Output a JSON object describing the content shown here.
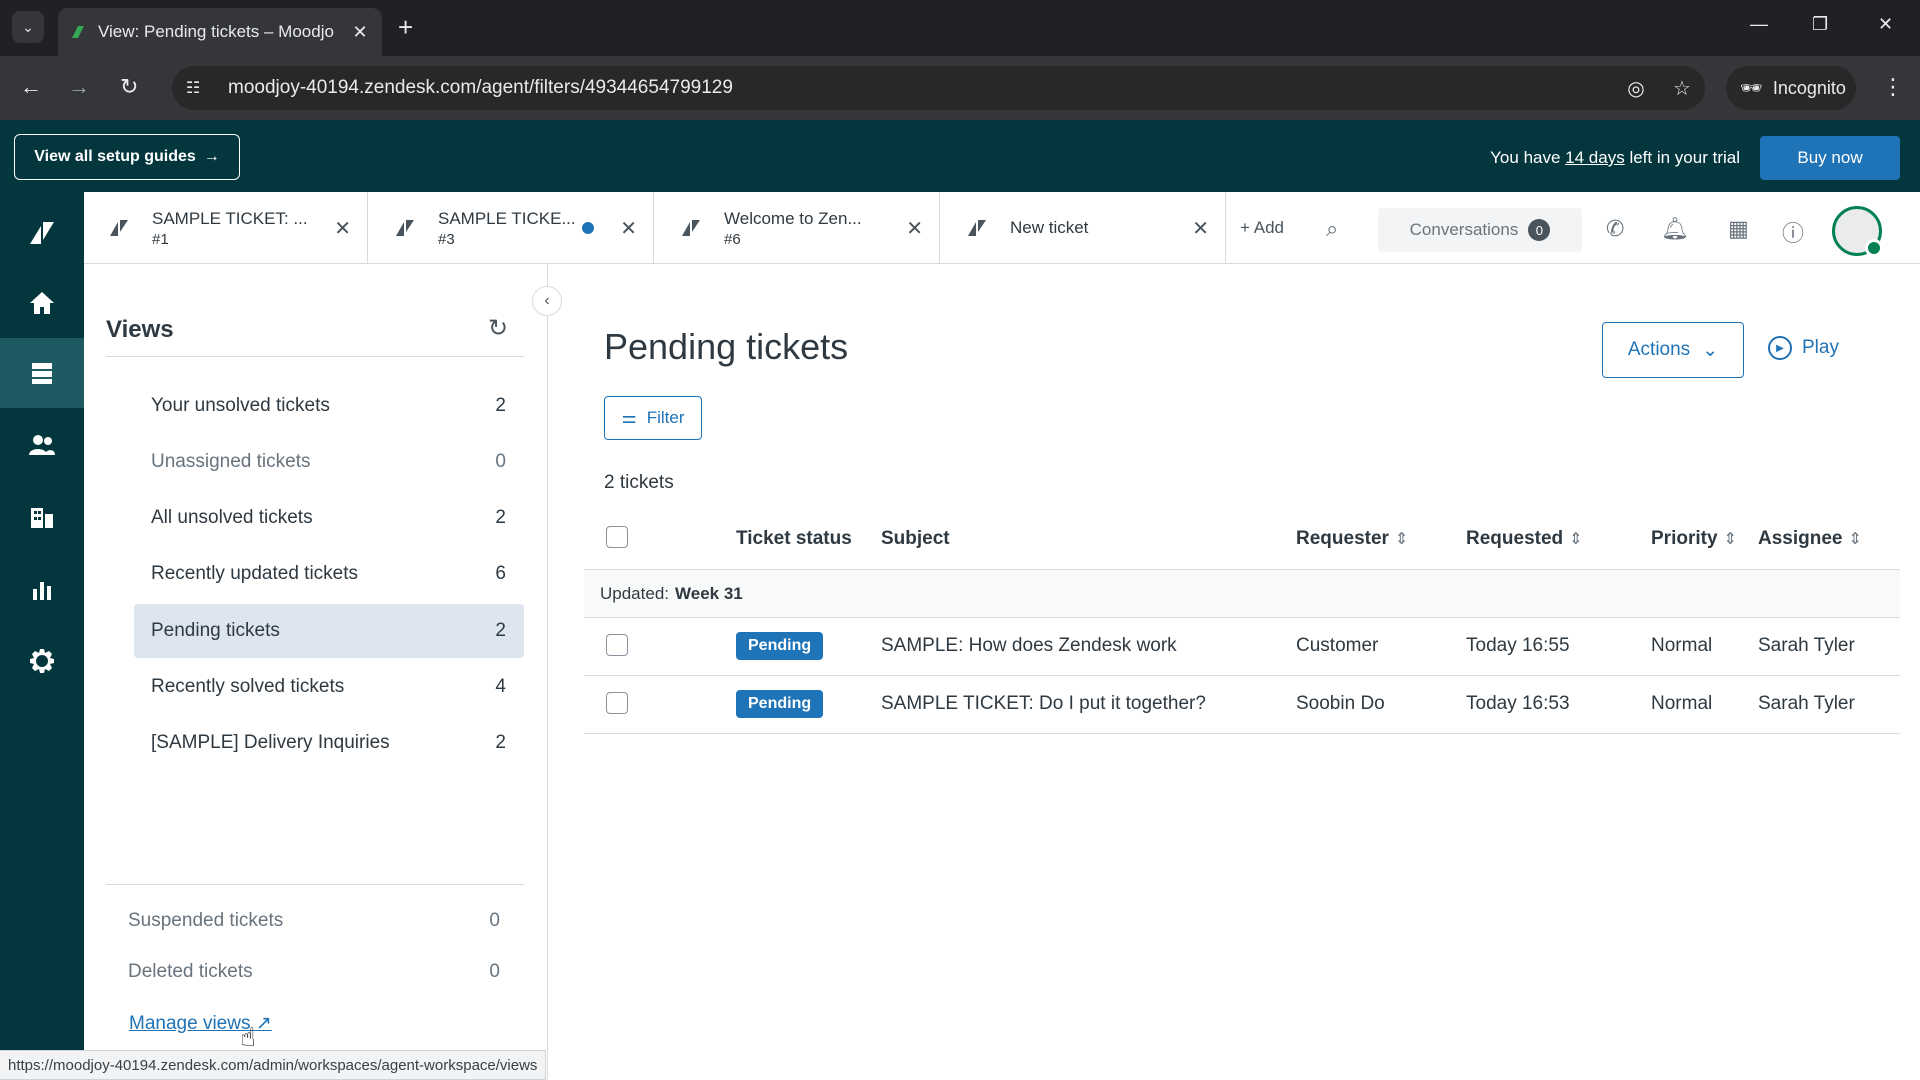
{
  "browser": {
    "tab_title": "View: Pending tickets – Moodjo",
    "url": "moodjoy-40194.zendesk.com/agent/filters/49344654799129",
    "incognito_label": "Incognito",
    "status_url": "https://moodjoy-40194.zendesk.com/admin/workspaces/agent-workspace/views"
  },
  "trial": {
    "guides_label": "View all setup guides",
    "text_before": "You have",
    "days_link": "14 days",
    "text_after": "left in your trial",
    "buy_label": "Buy now"
  },
  "workspace_tabs": [
    {
      "title": "SAMPLE TICKET: ...",
      "sub": "#1"
    },
    {
      "title": "SAMPLE TICKE...",
      "sub": "#3"
    },
    {
      "title": "Welcome to Zen...",
      "sub": "#6"
    },
    {
      "title": "New ticket",
      "sub": ""
    }
  ],
  "header": {
    "add_label": "Add",
    "conversations_label": "Conversations",
    "conversations_count": "0"
  },
  "views": {
    "title": "Views",
    "items": [
      {
        "label": "Your unsolved tickets",
        "count": "2"
      },
      {
        "label": "Unassigned tickets",
        "count": "0"
      },
      {
        "label": "All unsolved tickets",
        "count": "2"
      },
      {
        "label": "Recently updated tickets",
        "count": "6"
      },
      {
        "label": "Pending tickets",
        "count": "2"
      },
      {
        "label": "Recently solved tickets",
        "count": "4"
      },
      {
        "label": "[SAMPLE] Delivery Inquiries",
        "count": "2"
      }
    ],
    "secondary": [
      {
        "label": "Suspended tickets",
        "count": "0"
      },
      {
        "label": "Deleted tickets",
        "count": "0"
      }
    ],
    "manage_label": "Manage views"
  },
  "main": {
    "title": "Pending tickets",
    "actions_label": "Actions",
    "play_label": "Play",
    "filter_label": "Filter",
    "count_text": "2 tickets",
    "columns": {
      "status": "Ticket status",
      "subject": "Subject",
      "requester": "Requester",
      "requested": "Requested",
      "priority": "Priority",
      "assignee": "Assignee"
    },
    "group_label": "Updated:",
    "group_value": "Week 31",
    "rows": [
      {
        "status": "Pending",
        "subject": "SAMPLE: How does Zendesk work",
        "requester": "Customer",
        "requested": "Today 16:55",
        "priority": "Normal",
        "assignee": "Sarah Tyler"
      },
      {
        "status": "Pending",
        "subject": "SAMPLE TICKET: Do I put it together?",
        "requester": "Soobin Do",
        "requested": "Today 16:53",
        "priority": "Normal",
        "assignee": "Sarah Tyler"
      }
    ]
  },
  "colors": {
    "brand_dark": "#03363d",
    "primary_blue": "#1f73b7",
    "active_view_bg": "#dde6ef"
  }
}
